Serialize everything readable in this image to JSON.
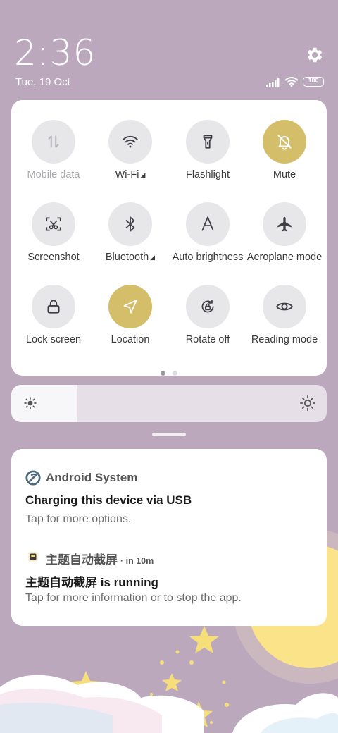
{
  "status": {
    "time": "2:36",
    "date": "Tue, 19 Oct",
    "battery": "100",
    "icons": [
      "signal-icon",
      "wifi-icon",
      "battery-icon"
    ],
    "settings_icon": "gear-icon"
  },
  "quick_settings": {
    "tiles": [
      {
        "label": "Mobile data",
        "icon": "mobile-data-icon",
        "active": false,
        "disabled": true,
        "expand": false
      },
      {
        "label": "Wi-Fi",
        "icon": "wifi-icon",
        "active": false,
        "disabled": false,
        "expand": true
      },
      {
        "label": "Flashlight",
        "icon": "flashlight-icon",
        "active": false,
        "disabled": false,
        "expand": false
      },
      {
        "label": "Mute",
        "icon": "bell-off-icon",
        "active": true,
        "disabled": false,
        "expand": false
      },
      {
        "label": "Screenshot",
        "icon": "screenshot-scissors-icon",
        "active": false,
        "disabled": false,
        "expand": false
      },
      {
        "label": "Bluetooth",
        "icon": "bluetooth-icon",
        "active": false,
        "disabled": false,
        "expand": true
      },
      {
        "label": "Auto brightness",
        "icon": "auto-brightness-icon",
        "active": false,
        "disabled": false,
        "expand": false
      },
      {
        "label": "Aeroplane mode",
        "icon": "aeroplane-icon",
        "active": false,
        "disabled": false,
        "expand": false
      },
      {
        "label": "Lock screen",
        "icon": "lock-icon",
        "active": false,
        "disabled": false,
        "expand": false
      },
      {
        "label": "Location",
        "icon": "location-arrow-icon",
        "active": true,
        "disabled": false,
        "expand": false
      },
      {
        "label": "Rotate off",
        "icon": "rotate-lock-icon",
        "active": false,
        "disabled": false,
        "expand": false
      },
      {
        "label": "Reading mode",
        "icon": "eye-icon",
        "active": false,
        "disabled": false,
        "expand": false
      }
    ],
    "page_count": 2,
    "current_page": 1
  },
  "brightness": {
    "level": 0.21,
    "icon_low": "sun-small-icon",
    "icon_high": "sun-large-icon"
  },
  "notifications": [
    {
      "app": "Android System",
      "time": "",
      "title": "Charging this device via USB",
      "body": "Tap for more options.",
      "icon": "android-system-icon"
    },
    {
      "app": "主题自动截屏",
      "time": "· in 10m",
      "title": "主题自动截屏 is running",
      "body": "Tap for more information or to stop the app.",
      "icon": "app-icon"
    }
  ],
  "colors": {
    "wallpaper": "#bba8bd",
    "panel": "#ffffff",
    "tile_off": "#e7e7e9",
    "tile_on": "#d4be6a",
    "moon": "#fbe38a"
  }
}
